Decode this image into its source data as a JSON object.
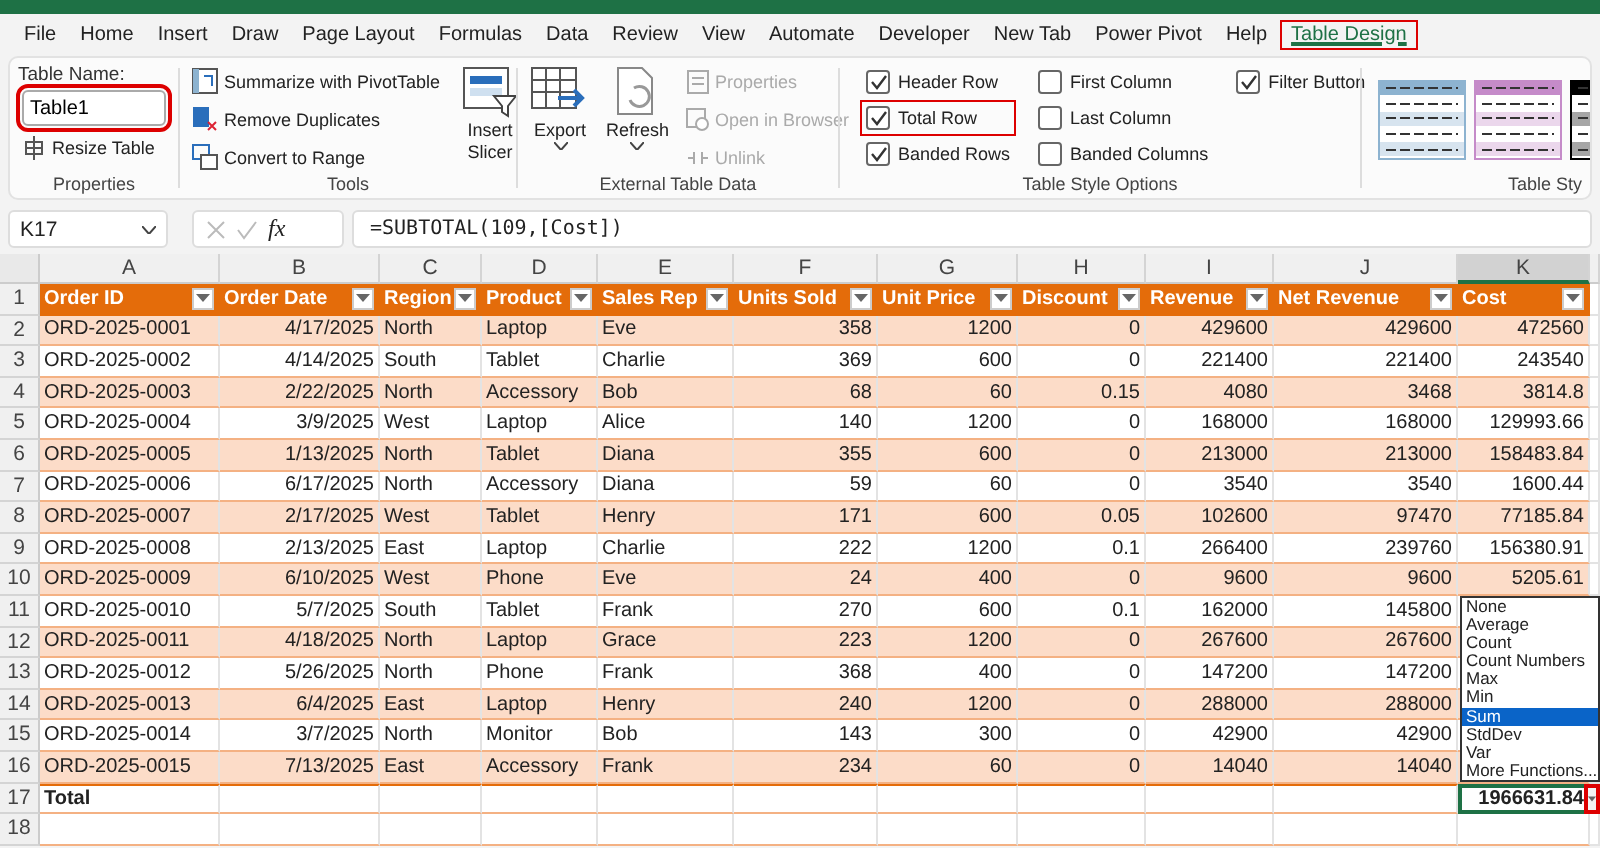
{
  "tabs": [
    {
      "label": "File",
      "selected": false,
      "highlighted": false
    },
    {
      "label": "Home",
      "selected": false,
      "highlighted": false
    },
    {
      "label": "Insert",
      "selected": false,
      "highlighted": false
    },
    {
      "label": "Draw",
      "selected": false,
      "highlighted": false
    },
    {
      "label": "Page Layout",
      "selected": false,
      "highlighted": false
    },
    {
      "label": "Formulas",
      "selected": false,
      "highlighted": false
    },
    {
      "label": "Data",
      "selected": false,
      "highlighted": false
    },
    {
      "label": "Review",
      "selected": false,
      "highlighted": false
    },
    {
      "label": "View",
      "selected": false,
      "highlighted": false
    },
    {
      "label": "Automate",
      "selected": false,
      "highlighted": false
    },
    {
      "label": "Developer",
      "selected": false,
      "highlighted": false
    },
    {
      "label": "New Tab",
      "selected": false,
      "highlighted": false
    },
    {
      "label": "Power Pivot",
      "selected": false,
      "highlighted": false
    },
    {
      "label": "Help",
      "selected": false,
      "highlighted": false
    },
    {
      "label": "Table Design",
      "selected": true,
      "highlighted": true
    }
  ],
  "ribbon": {
    "properties": {
      "label": "Properties",
      "name_label": "Table Name:",
      "name_value": "Table1",
      "highlighted": true,
      "resize": "Resize Table"
    },
    "tools": {
      "label": "Tools",
      "items": [
        {
          "label": "Summarize with PivotTable"
        },
        {
          "label": "Remove Duplicates"
        },
        {
          "label": "Convert to Range"
        }
      ],
      "slicer": "Insert Slicer"
    },
    "external": {
      "label": "External Table Data",
      "large": [
        {
          "label": "Export"
        },
        {
          "label": "Refresh"
        }
      ],
      "small": [
        {
          "label": "Properties",
          "disabled": true
        },
        {
          "label": "Open in Browser",
          "disabled": true
        },
        {
          "label": "Unlink",
          "disabled": true
        }
      ]
    },
    "style_options": {
      "label": "Table Style Options",
      "options": [
        {
          "label": "Header Row",
          "kind": "header_row",
          "checked": true,
          "highlighted": false
        },
        {
          "label": "Total Row",
          "kind": "total_row",
          "checked": true,
          "highlighted": true
        },
        {
          "label": "Banded Rows",
          "kind": "banded_rows",
          "checked": true,
          "highlighted": false
        },
        {
          "label": "First Column",
          "kind": "first_column",
          "checked": false,
          "highlighted": false
        },
        {
          "label": "Last Column",
          "kind": "last_column",
          "checked": false,
          "highlighted": false
        },
        {
          "label": "Banded Columns",
          "kind": "banded_columns",
          "checked": false,
          "highlighted": false
        },
        {
          "label": "Filter Button",
          "kind": "filter_button",
          "checked": true,
          "highlighted": false
        }
      ]
    },
    "table_styles": {
      "label": "Table Sty",
      "styles": [
        {
          "color": "#8db3d0"
        },
        {
          "color": "#c58bc9"
        },
        {
          "color": "#000000"
        }
      ]
    }
  },
  "formula_bar": {
    "name_box": "K17",
    "fx": "fx",
    "formula": "=SUBTOTAL(109,[Cost])"
  },
  "sheet": {
    "columns": [
      {
        "letter": "A",
        "header": "Order ID",
        "kind": "text",
        "selected": false
      },
      {
        "letter": "B",
        "header": "Order Date",
        "kind": "number",
        "selected": false
      },
      {
        "letter": "C",
        "header": "Region",
        "kind": "text",
        "selected": false
      },
      {
        "letter": "D",
        "header": "Product",
        "kind": "text",
        "selected": false
      },
      {
        "letter": "E",
        "header": "Sales Rep",
        "kind": "text",
        "selected": false
      },
      {
        "letter": "F",
        "header": "Units Sold",
        "kind": "number",
        "selected": false
      },
      {
        "letter": "G",
        "header": "Unit Price",
        "kind": "number",
        "selected": false
      },
      {
        "letter": "H",
        "header": "Discount",
        "kind": "number",
        "selected": false
      },
      {
        "letter": "I",
        "header": "Revenue",
        "kind": "number",
        "selected": false
      },
      {
        "letter": "J",
        "header": "Net Revenue",
        "kind": "number",
        "selected": false
      },
      {
        "letter": "K",
        "header": "Cost",
        "kind": "number",
        "selected": true
      }
    ],
    "header_row_number": "1",
    "rows": [
      {
        "n": "2",
        "cells": [
          "ORD-2025-0001",
          "4/17/2025",
          "North",
          "Laptop",
          "Eve",
          "358",
          "1200",
          "0",
          "429600",
          "429600",
          "472560"
        ]
      },
      {
        "n": "3",
        "cells": [
          "ORD-2025-0002",
          "4/14/2025",
          "South",
          "Tablet",
          "Charlie",
          "369",
          "600",
          "0",
          "221400",
          "221400",
          "243540"
        ]
      },
      {
        "n": "4",
        "cells": [
          "ORD-2025-0003",
          "2/22/2025",
          "North",
          "Accessory",
          "Bob",
          "68",
          "60",
          "0.15",
          "4080",
          "3468",
          "3814.8"
        ]
      },
      {
        "n": "5",
        "cells": [
          "ORD-2025-0004",
          "3/9/2025",
          "West",
          "Laptop",
          "Alice",
          "140",
          "1200",
          "0",
          "168000",
          "168000",
          "129993.66"
        ]
      },
      {
        "n": "6",
        "cells": [
          "ORD-2025-0005",
          "1/13/2025",
          "North",
          "Tablet",
          "Diana",
          "355",
          "600",
          "0",
          "213000",
          "213000",
          "158483.84"
        ]
      },
      {
        "n": "7",
        "cells": [
          "ORD-2025-0006",
          "6/17/2025",
          "North",
          "Accessory",
          "Diana",
          "59",
          "60",
          "0",
          "3540",
          "3540",
          "1600.44"
        ]
      },
      {
        "n": "8",
        "cells": [
          "ORD-2025-0007",
          "2/17/2025",
          "West",
          "Tablet",
          "Henry",
          "171",
          "600",
          "0.05",
          "102600",
          "97470",
          "77185.84"
        ]
      },
      {
        "n": "9",
        "cells": [
          "ORD-2025-0008",
          "2/13/2025",
          "East",
          "Laptop",
          "Charlie",
          "222",
          "1200",
          "0.1",
          "266400",
          "239760",
          "156380.91"
        ]
      },
      {
        "n": "10",
        "cells": [
          "ORD-2025-0009",
          "6/10/2025",
          "West",
          "Phone",
          "Eve",
          "24",
          "400",
          "0",
          "9600",
          "9600",
          "5205.61"
        ]
      },
      {
        "n": "11",
        "cells": [
          "ORD-2025-0010",
          "5/7/2025",
          "South",
          "Tablet",
          "Frank",
          "270",
          "600",
          "0.1",
          "162000",
          "145800",
          null
        ]
      },
      {
        "n": "12",
        "cells": [
          "ORD-2025-0011",
          "4/18/2025",
          "North",
          "Laptop",
          "Grace",
          "223",
          "1200",
          "0",
          "267600",
          "267600",
          null
        ]
      },
      {
        "n": "13",
        "cells": [
          "ORD-2025-0012",
          "5/26/2025",
          "North",
          "Phone",
          "Frank",
          "368",
          "400",
          "0",
          "147200",
          "147200",
          null
        ]
      },
      {
        "n": "14",
        "cells": [
          "ORD-2025-0013",
          "6/4/2025",
          "East",
          "Laptop",
          "Henry",
          "240",
          "1200",
          "0",
          "288000",
          "288000",
          null
        ]
      },
      {
        "n": "15",
        "cells": [
          "ORD-2025-0014",
          "3/7/2025",
          "North",
          "Monitor",
          "Bob",
          "143",
          "300",
          "0",
          "42900",
          "42900",
          null
        ]
      },
      {
        "n": "16",
        "cells": [
          "ORD-2025-0015",
          "7/13/2025",
          "East",
          "Accessory",
          "Frank",
          "234",
          "60",
          "0",
          "14040",
          "14040",
          null
        ]
      }
    ],
    "total": {
      "n": "17",
      "label": "Total",
      "value": "1966631.84",
      "selected": true
    },
    "empty_rows": [
      "18"
    ],
    "total_menu": {
      "highlighted": true,
      "items": [
        {
          "label": "None",
          "selected": false
        },
        {
          "label": "Average",
          "selected": false
        },
        {
          "label": "Count",
          "selected": false
        },
        {
          "label": "Count Numbers",
          "selected": false
        },
        {
          "label": "Max",
          "selected": false
        },
        {
          "label": "Min",
          "selected": false
        },
        {
          "label": "Sum",
          "selected": true
        },
        {
          "label": "StdDev",
          "selected": false
        },
        {
          "label": "Var",
          "selected": false
        },
        {
          "label": "More Functions...",
          "selected": false
        }
      ]
    }
  }
}
